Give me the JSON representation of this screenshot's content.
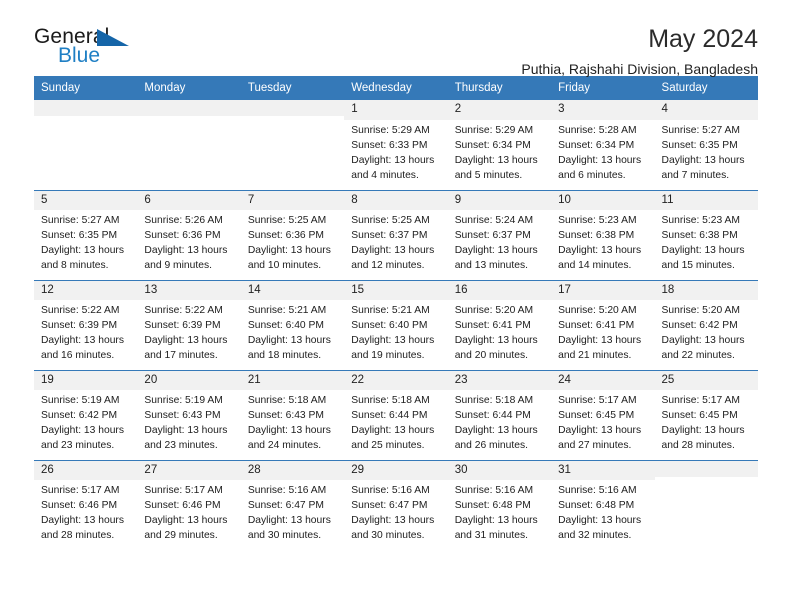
{
  "brand": {
    "name_part1": "General",
    "name_part2": "Blue",
    "accent_color": "#1565a8",
    "blue_text_color": "#1f7fc4"
  },
  "header": {
    "title": "May 2024",
    "subtitle": "Puthia, Rajshahi Division, Bangladesh"
  },
  "calendar": {
    "header_bg": "#3579b8",
    "daynum_bg": "#f1f1f1",
    "weekday_headers": [
      "Sunday",
      "Monday",
      "Tuesday",
      "Wednesday",
      "Thursday",
      "Friday",
      "Saturday"
    ],
    "weeks": [
      [
        {
          "day": "",
          "sunrise": "",
          "sunset": "",
          "daylight": "",
          "empty": true
        },
        {
          "day": "",
          "sunrise": "",
          "sunset": "",
          "daylight": "",
          "empty": true
        },
        {
          "day": "",
          "sunrise": "",
          "sunset": "",
          "daylight": "",
          "empty": true
        },
        {
          "day": "1",
          "sunrise": "Sunrise: 5:29 AM",
          "sunset": "Sunset: 6:33 PM",
          "daylight": "Daylight: 13 hours and 4 minutes."
        },
        {
          "day": "2",
          "sunrise": "Sunrise: 5:29 AM",
          "sunset": "Sunset: 6:34 PM",
          "daylight": "Daylight: 13 hours and 5 minutes."
        },
        {
          "day": "3",
          "sunrise": "Sunrise: 5:28 AM",
          "sunset": "Sunset: 6:34 PM",
          "daylight": "Daylight: 13 hours and 6 minutes."
        },
        {
          "day": "4",
          "sunrise": "Sunrise: 5:27 AM",
          "sunset": "Sunset: 6:35 PM",
          "daylight": "Daylight: 13 hours and 7 minutes."
        }
      ],
      [
        {
          "day": "5",
          "sunrise": "Sunrise: 5:27 AM",
          "sunset": "Sunset: 6:35 PM",
          "daylight": "Daylight: 13 hours and 8 minutes."
        },
        {
          "day": "6",
          "sunrise": "Sunrise: 5:26 AM",
          "sunset": "Sunset: 6:36 PM",
          "daylight": "Daylight: 13 hours and 9 minutes."
        },
        {
          "day": "7",
          "sunrise": "Sunrise: 5:25 AM",
          "sunset": "Sunset: 6:36 PM",
          "daylight": "Daylight: 13 hours and 10 minutes."
        },
        {
          "day": "8",
          "sunrise": "Sunrise: 5:25 AM",
          "sunset": "Sunset: 6:37 PM",
          "daylight": "Daylight: 13 hours and 12 minutes."
        },
        {
          "day": "9",
          "sunrise": "Sunrise: 5:24 AM",
          "sunset": "Sunset: 6:37 PM",
          "daylight": "Daylight: 13 hours and 13 minutes."
        },
        {
          "day": "10",
          "sunrise": "Sunrise: 5:23 AM",
          "sunset": "Sunset: 6:38 PM",
          "daylight": "Daylight: 13 hours and 14 minutes."
        },
        {
          "day": "11",
          "sunrise": "Sunrise: 5:23 AM",
          "sunset": "Sunset: 6:38 PM",
          "daylight": "Daylight: 13 hours and 15 minutes."
        }
      ],
      [
        {
          "day": "12",
          "sunrise": "Sunrise: 5:22 AM",
          "sunset": "Sunset: 6:39 PM",
          "daylight": "Daylight: 13 hours and 16 minutes."
        },
        {
          "day": "13",
          "sunrise": "Sunrise: 5:22 AM",
          "sunset": "Sunset: 6:39 PM",
          "daylight": "Daylight: 13 hours and 17 minutes."
        },
        {
          "day": "14",
          "sunrise": "Sunrise: 5:21 AM",
          "sunset": "Sunset: 6:40 PM",
          "daylight": "Daylight: 13 hours and 18 minutes."
        },
        {
          "day": "15",
          "sunrise": "Sunrise: 5:21 AM",
          "sunset": "Sunset: 6:40 PM",
          "daylight": "Daylight: 13 hours and 19 minutes."
        },
        {
          "day": "16",
          "sunrise": "Sunrise: 5:20 AM",
          "sunset": "Sunset: 6:41 PM",
          "daylight": "Daylight: 13 hours and 20 minutes."
        },
        {
          "day": "17",
          "sunrise": "Sunrise: 5:20 AM",
          "sunset": "Sunset: 6:41 PM",
          "daylight": "Daylight: 13 hours and 21 minutes."
        },
        {
          "day": "18",
          "sunrise": "Sunrise: 5:20 AM",
          "sunset": "Sunset: 6:42 PM",
          "daylight": "Daylight: 13 hours and 22 minutes."
        }
      ],
      [
        {
          "day": "19",
          "sunrise": "Sunrise: 5:19 AM",
          "sunset": "Sunset: 6:42 PM",
          "daylight": "Daylight: 13 hours and 23 minutes."
        },
        {
          "day": "20",
          "sunrise": "Sunrise: 5:19 AM",
          "sunset": "Sunset: 6:43 PM",
          "daylight": "Daylight: 13 hours and 23 minutes."
        },
        {
          "day": "21",
          "sunrise": "Sunrise: 5:18 AM",
          "sunset": "Sunset: 6:43 PM",
          "daylight": "Daylight: 13 hours and 24 minutes."
        },
        {
          "day": "22",
          "sunrise": "Sunrise: 5:18 AM",
          "sunset": "Sunset: 6:44 PM",
          "daylight": "Daylight: 13 hours and 25 minutes."
        },
        {
          "day": "23",
          "sunrise": "Sunrise: 5:18 AM",
          "sunset": "Sunset: 6:44 PM",
          "daylight": "Daylight: 13 hours and 26 minutes."
        },
        {
          "day": "24",
          "sunrise": "Sunrise: 5:17 AM",
          "sunset": "Sunset: 6:45 PM",
          "daylight": "Daylight: 13 hours and 27 minutes."
        },
        {
          "day": "25",
          "sunrise": "Sunrise: 5:17 AM",
          "sunset": "Sunset: 6:45 PM",
          "daylight": "Daylight: 13 hours and 28 minutes."
        }
      ],
      [
        {
          "day": "26",
          "sunrise": "Sunrise: 5:17 AM",
          "sunset": "Sunset: 6:46 PM",
          "daylight": "Daylight: 13 hours and 28 minutes."
        },
        {
          "day": "27",
          "sunrise": "Sunrise: 5:17 AM",
          "sunset": "Sunset: 6:46 PM",
          "daylight": "Daylight: 13 hours and 29 minutes."
        },
        {
          "day": "28",
          "sunrise": "Sunrise: 5:16 AM",
          "sunset": "Sunset: 6:47 PM",
          "daylight": "Daylight: 13 hours and 30 minutes."
        },
        {
          "day": "29",
          "sunrise": "Sunrise: 5:16 AM",
          "sunset": "Sunset: 6:47 PM",
          "daylight": "Daylight: 13 hours and 30 minutes."
        },
        {
          "day": "30",
          "sunrise": "Sunrise: 5:16 AM",
          "sunset": "Sunset: 6:48 PM",
          "daylight": "Daylight: 13 hours and 31 minutes."
        },
        {
          "day": "31",
          "sunrise": "Sunrise: 5:16 AM",
          "sunset": "Sunset: 6:48 PM",
          "daylight": "Daylight: 13 hours and 32 minutes."
        },
        {
          "day": "",
          "sunrise": "",
          "sunset": "",
          "daylight": "",
          "empty": true
        }
      ]
    ]
  }
}
